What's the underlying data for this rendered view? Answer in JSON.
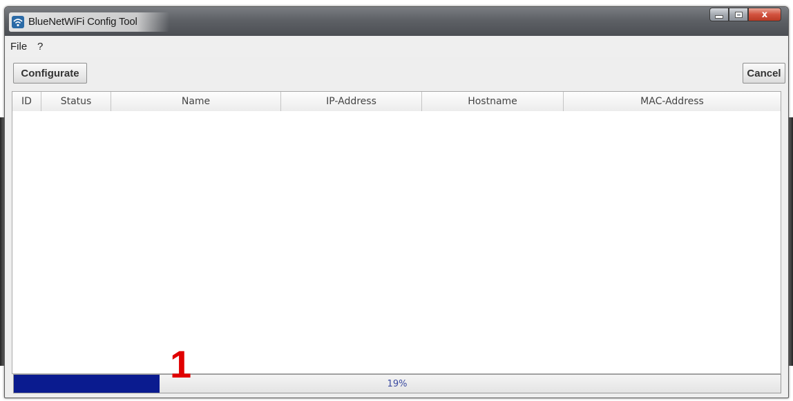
{
  "window": {
    "title": "BlueNetWiFi Config Tool",
    "controls": {
      "minimize": "minimize",
      "maximize": "maximize",
      "close": "x"
    }
  },
  "menu": {
    "items": [
      "File",
      "?"
    ]
  },
  "toolbar": {
    "configurate_label": "Configurate",
    "cancel_label": "Cancel"
  },
  "table": {
    "columns": [
      "ID",
      "Status",
      "Name",
      "IP-Address",
      "Hostname",
      "MAC-Address"
    ],
    "rows": []
  },
  "progress": {
    "percent": 19,
    "label": "19%",
    "fill_color": "#0a1b8f"
  },
  "annotation": {
    "text": "1",
    "color": "#e00000"
  },
  "icons": {
    "app": "wifi-icon"
  }
}
